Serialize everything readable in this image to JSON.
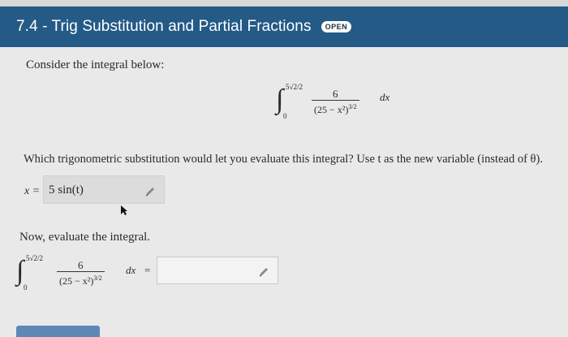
{
  "header": {
    "title": "7.4 - Trig Substitution and Partial Fractions",
    "badge": "OPEN"
  },
  "prompt": "Consider the integral below:",
  "integral": {
    "upper": "5√2/2",
    "lower": "0",
    "numerator": "6",
    "denominator": "(25 − x²)",
    "exponent": "3/2",
    "dx": "dx"
  },
  "question1": "Which trigonometric substitution would let you evaluate this integral? Use t as the new variable (instead of θ).",
  "answer1": {
    "lhs": "x =",
    "value": "5 sin(t)"
  },
  "question2": "Now, evaluate the integral.",
  "answer2": {
    "equals": "=",
    "value": ""
  }
}
